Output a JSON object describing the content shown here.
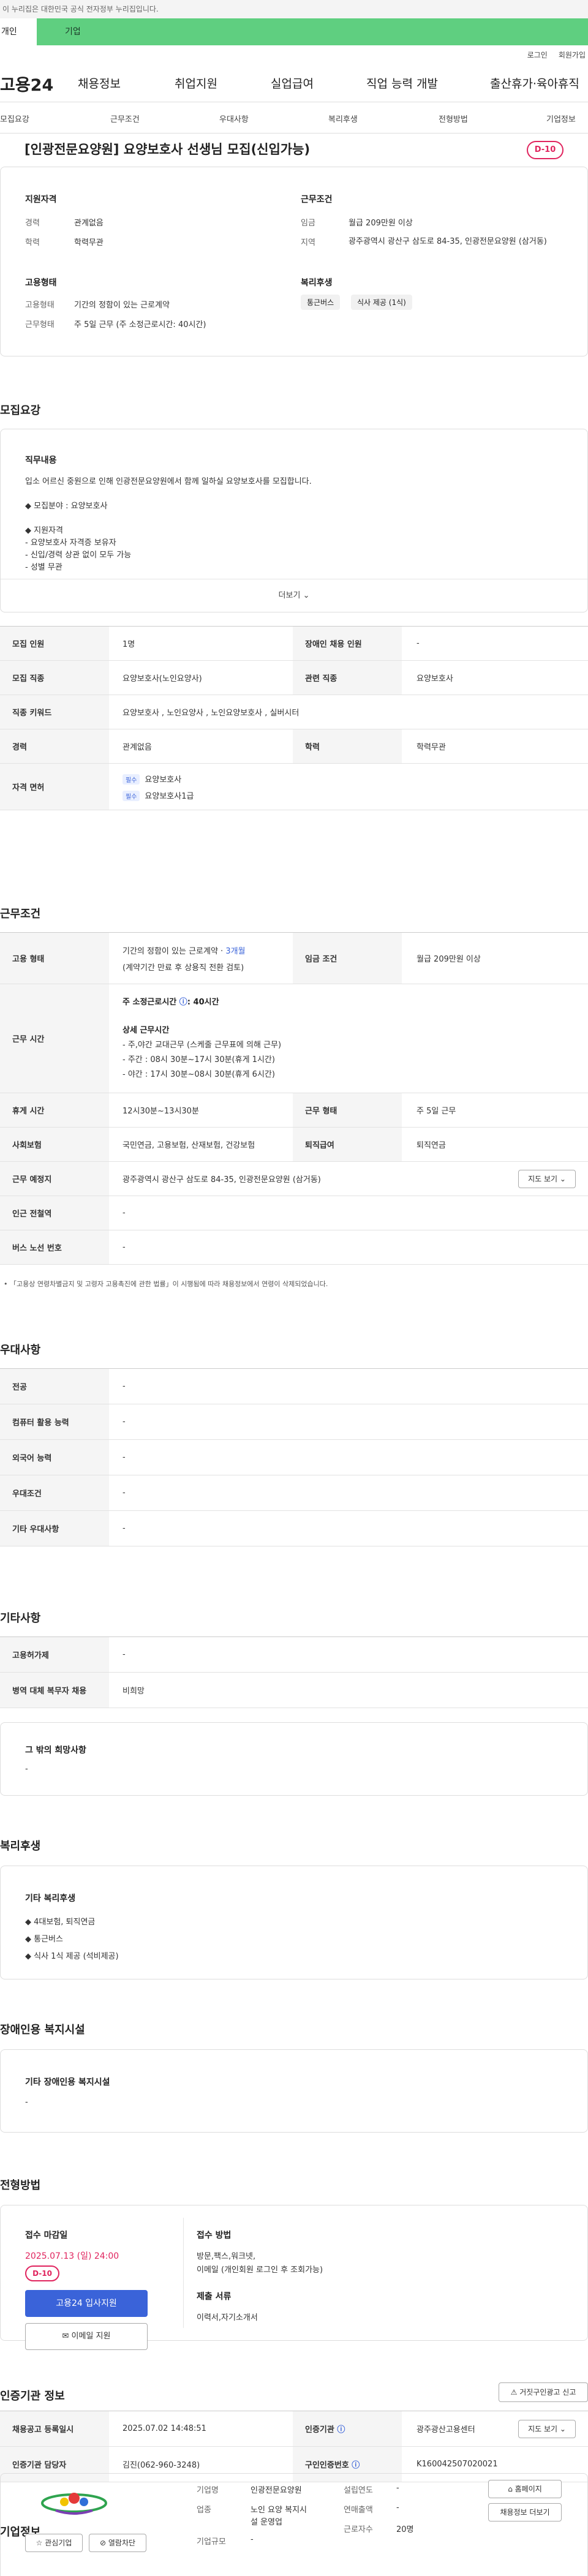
{
  "gov_banner": "이 누리집은 대한민국 공식 전자정부 누리집입니다.",
  "top_tabs": [
    "개인",
    "기업"
  ],
  "util_links": [
    "로그인",
    "회원가입"
  ],
  "logo": "고용24",
  "gnb": [
    "채용정보",
    "취업지원",
    "실업급여",
    "직업 능력 개발",
    "출산휴가·육아휴직"
  ],
  "subnav": [
    "모집요강",
    "근무조건",
    "우대사항",
    "복리후생",
    "전형방법",
    "기업정보"
  ],
  "title": "[인광전문요양원] 요양보호사 선생님 모집(신입가능)",
  "dday": "D-10",
  "summary": {
    "qual_h": "지원자격",
    "exp_l": "경력",
    "exp_v": "관계없음",
    "edu_l": "학력",
    "edu_v": "학력무관",
    "cond_h": "근무조건",
    "wage_l": "임금",
    "wage_v": "월급 209만원 이상",
    "area_l": "지역",
    "area_v": "광주광역시 광산구 삼도로 84-35, 인광전문요양원 (삼거동)",
    "emp_h": "고용형태",
    "type_l": "고용형태",
    "type_v": "기간의 정함이 있는 근로계약",
    "form_l": "근무형태",
    "form_v": "주 5일 근무 (주 소정근로시간: 40시간)",
    "welfare_h": "복리후생",
    "welfare_tags": [
      "통근버스",
      "식사 제공 (1식)"
    ]
  },
  "recruit": {
    "h": "모집요강",
    "job_h": "직무내용",
    "job_lines": [
      "입소 어르신 중원으로 인해 인광전문요양원에서 함께 일하실 요양보호사를 모집합니다.",
      "◆ 모집분야 : 요양보호사",
      "◆ 지원자격",
      "- 요양보호사 자격증 보유자",
      "- 신입/경력 상관 없이 모두 가능",
      "- 성별 무관"
    ],
    "more": "더보기",
    "rows": [
      {
        "th": "모집 인원",
        "td": "1명",
        "th2": "장애인 채용 인원",
        "td2": "-"
      },
      {
        "th": "모집 직종",
        "td": "요양보호사(노인요양사)",
        "th2": "관련 직종",
        "td2": "요양보호사"
      },
      {
        "th": "직종 키워드",
        "td": "요양보호사 , 노인요양사 , 노인요양보호사 , 실버시터"
      },
      {
        "th": "경력",
        "td": "관계없음",
        "th2": "학력",
        "td2": "학력무관"
      }
    ],
    "license_th": "자격 면허",
    "license_tag": "필수",
    "licenses": [
      "요양보호사",
      "요양보호사1급"
    ]
  },
  "work": {
    "h": "근무조건",
    "emp_th": "고용 형태",
    "emp_td": "기간의 정함이 있는 근로계약 · ",
    "emp_period": "3개월",
    "emp_td_sub": "(계약기간 만료 후 상용직 전환 검토)",
    "wage_th": "임금 조건",
    "wage_td": "월급 209만원 이상",
    "time_th": "근무 시간",
    "time_main": "주 소정근로시간",
    "time_val": ": 40시간",
    "time_detail_h": "상세 근무시간",
    "time_lines": [
      "- 주,야간 교대근무 (스케줄 근무표에 의해 근무)",
      "- 주간 : 08시 30분~17시 30분(휴게 1시간)",
      "- 야간 : 17시 30분~08시 30분(휴게 6시간)"
    ],
    "rest_th": "휴게 시간",
    "rest_td": "12시30분~13시30분",
    "form_th": "근무 형태",
    "form_td": "주 5일 근무",
    "ins_th": "사회보험",
    "ins_td": "국민연금, 고용보험, 산재보험, 건강보험",
    "ret_th": "퇴직급여",
    "ret_td": "퇴직연금",
    "place_th": "근무 예정지",
    "place_td": "광주광역시 광산구 삼도로 84-35, 인광전문요양원 (삼거동)",
    "map_btn": "지도 보기",
    "subway_th": "인근 전철역",
    "subway_td": "-",
    "bus_th": "버스 노선 번호",
    "bus_td": "-",
    "note": "「고용상 연령차별금지 및 고령자 고용촉진에 관한 법률」이 시행됨에 따라 채용정보에서 연령이 삭제되었습니다."
  },
  "pref": {
    "h": "우대사항",
    "rows": [
      {
        "th": "전공",
        "td": "-"
      },
      {
        "th": "컴퓨터 활용 능력",
        "td": "-"
      },
      {
        "th": "외국어 능력",
        "td": "-"
      },
      {
        "th": "우대조건",
        "td": "-"
      },
      {
        "th": "기타 우대사항",
        "td": "-"
      }
    ]
  },
  "etc": {
    "h": "기타사항",
    "rows": [
      {
        "th": "고용허가제",
        "td": "-"
      },
      {
        "th": "병역 대체 복무자 채용",
        "td": "비희망"
      }
    ],
    "other_h": "그 밖의 희망사항",
    "other_v": "-"
  },
  "benefit": {
    "h": "복리후생",
    "box_h": "기타 복리후생",
    "lines": [
      "◆ 4대보험, 퇴직연금",
      "◆ 통근버스",
      "◆ 식사 1식 제공 (석비제공)"
    ]
  },
  "disab": {
    "h": "장애인용 복지시설",
    "box_h": "기타 장애인용 복지시설",
    "val": "-"
  },
  "selection": {
    "h": "전형방법",
    "deadline_h": "접수 마감일",
    "deadline": "2025.07.13 (일) 24:00",
    "dday": "D-10",
    "apply_btn": "고용24 입사지원",
    "email_btn": "이메일 지원",
    "method_h": "접수 방법",
    "method_lines": [
      "방문,팩스,워크넷,",
      "이메일 (개인회원 로그인 후 조회가능)"
    ],
    "docs_h": "제출 서류",
    "docs": "이력서,자기소개서"
  },
  "cert": {
    "h": "인증기관 정보",
    "report_btn": "거짓구인광고 신고",
    "reg_th": "채용공고 등록일시",
    "reg_td": "2025.07.02 14:48:51",
    "org_th": "인증기관",
    "org_td": "광주광산고용센터",
    "map_btn": "지도 보기",
    "mgr_th": "인증기관 담당자",
    "mgr_td": "김진(062-960-3248)",
    "no_th": "구인인증번호",
    "no_td": "K160042507020021"
  },
  "company": {
    "h": "기업정보",
    "fav_btn": "관심기업",
    "block_btn": "열람차단",
    "name_l": "기업명",
    "name_v": "인광전문요양원",
    "ind_l": "업종",
    "ind_v": [
      "노인 요양 복지시",
      "설 운영업"
    ],
    "size_l": "기업규모",
    "size_v": "-",
    "year_l": "설립연도",
    "year_v": "-",
    "sales_l": "연매출액",
    "sales_v": "-",
    "emp_l": "근로자수",
    "emp_v": "20명",
    "home_btn": "홈페이지",
    "jobs_btn": "채용정보 더보기"
  }
}
